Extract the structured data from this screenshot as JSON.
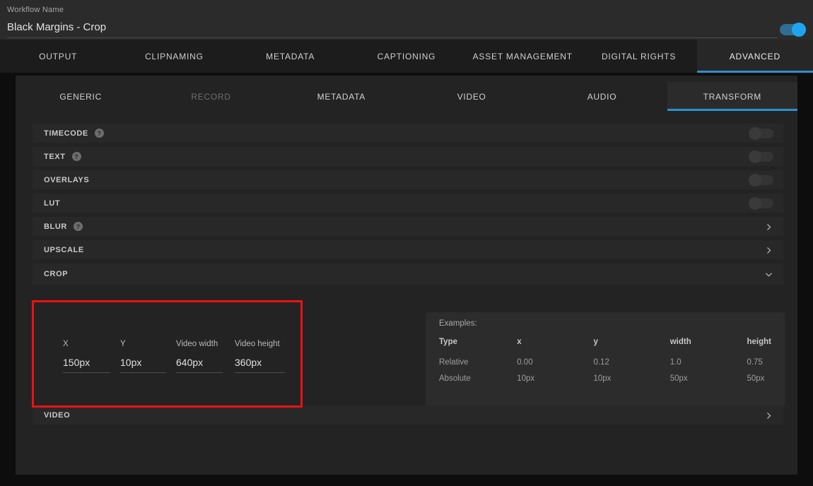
{
  "header": {
    "workflow_label": "Workflow Name",
    "workflow_value": "Black Margins - Crop",
    "enabled_toggle": "on",
    "accent_blue": "#21a4ef"
  },
  "tabs": [
    {
      "label": "OUTPUT",
      "active": false
    },
    {
      "label": "CLIPNAMING",
      "active": false
    },
    {
      "label": "METADATA",
      "active": false
    },
    {
      "label": "CAPTIONING",
      "active": false
    },
    {
      "label": "ASSET MANAGEMENT",
      "active": false
    },
    {
      "label": "DIGITAL RIGHTS",
      "active": false
    },
    {
      "label": "ADVANCED",
      "active": true
    }
  ],
  "subtabs": [
    {
      "label": "GENERIC",
      "active": false,
      "disabled": false
    },
    {
      "label": "RECORD",
      "active": false,
      "disabled": true
    },
    {
      "label": "METADATA",
      "active": false,
      "disabled": false
    },
    {
      "label": "VIDEO",
      "active": false,
      "disabled": false
    },
    {
      "label": "AUDIO",
      "active": false,
      "disabled": false
    },
    {
      "label": "TRANSFORM",
      "active": true,
      "disabled": false
    }
  ],
  "sections": [
    {
      "title": "TIMECODE",
      "help": true,
      "control": "toggle-off"
    },
    {
      "title": "TEXT",
      "help": true,
      "control": "toggle-off"
    },
    {
      "title": "OVERLAYS",
      "help": false,
      "control": "toggle-off"
    },
    {
      "title": "LUT",
      "help": false,
      "control": "toggle-off"
    },
    {
      "title": "BLUR",
      "help": true,
      "control": "chevron-right"
    },
    {
      "title": "UPSCALE",
      "help": false,
      "control": "chevron-right"
    },
    {
      "title": "CROP",
      "help": false,
      "control": "chevron-down",
      "expanded": true
    },
    {
      "title": "VIDEO",
      "help": false,
      "control": "chevron-right"
    }
  ],
  "crop": {
    "fields": [
      {
        "label": "X",
        "value": "150px"
      },
      {
        "label": "Y",
        "value": "10px"
      },
      {
        "label": "Video width",
        "value": "640px"
      },
      {
        "label": "Video height",
        "value": "360px"
      }
    ],
    "examples": {
      "title": "Examples:",
      "columns": [
        "Type",
        "x",
        "y",
        "width",
        "height"
      ],
      "rows": [
        [
          "Relative",
          "0.00",
          "0.12",
          "1.0",
          "0.75"
        ],
        [
          "Absolute",
          "10px",
          "10px",
          "50px",
          "50px"
        ]
      ]
    }
  },
  "annotation": {
    "color": "#ee1111"
  },
  "help_glyph": "?"
}
